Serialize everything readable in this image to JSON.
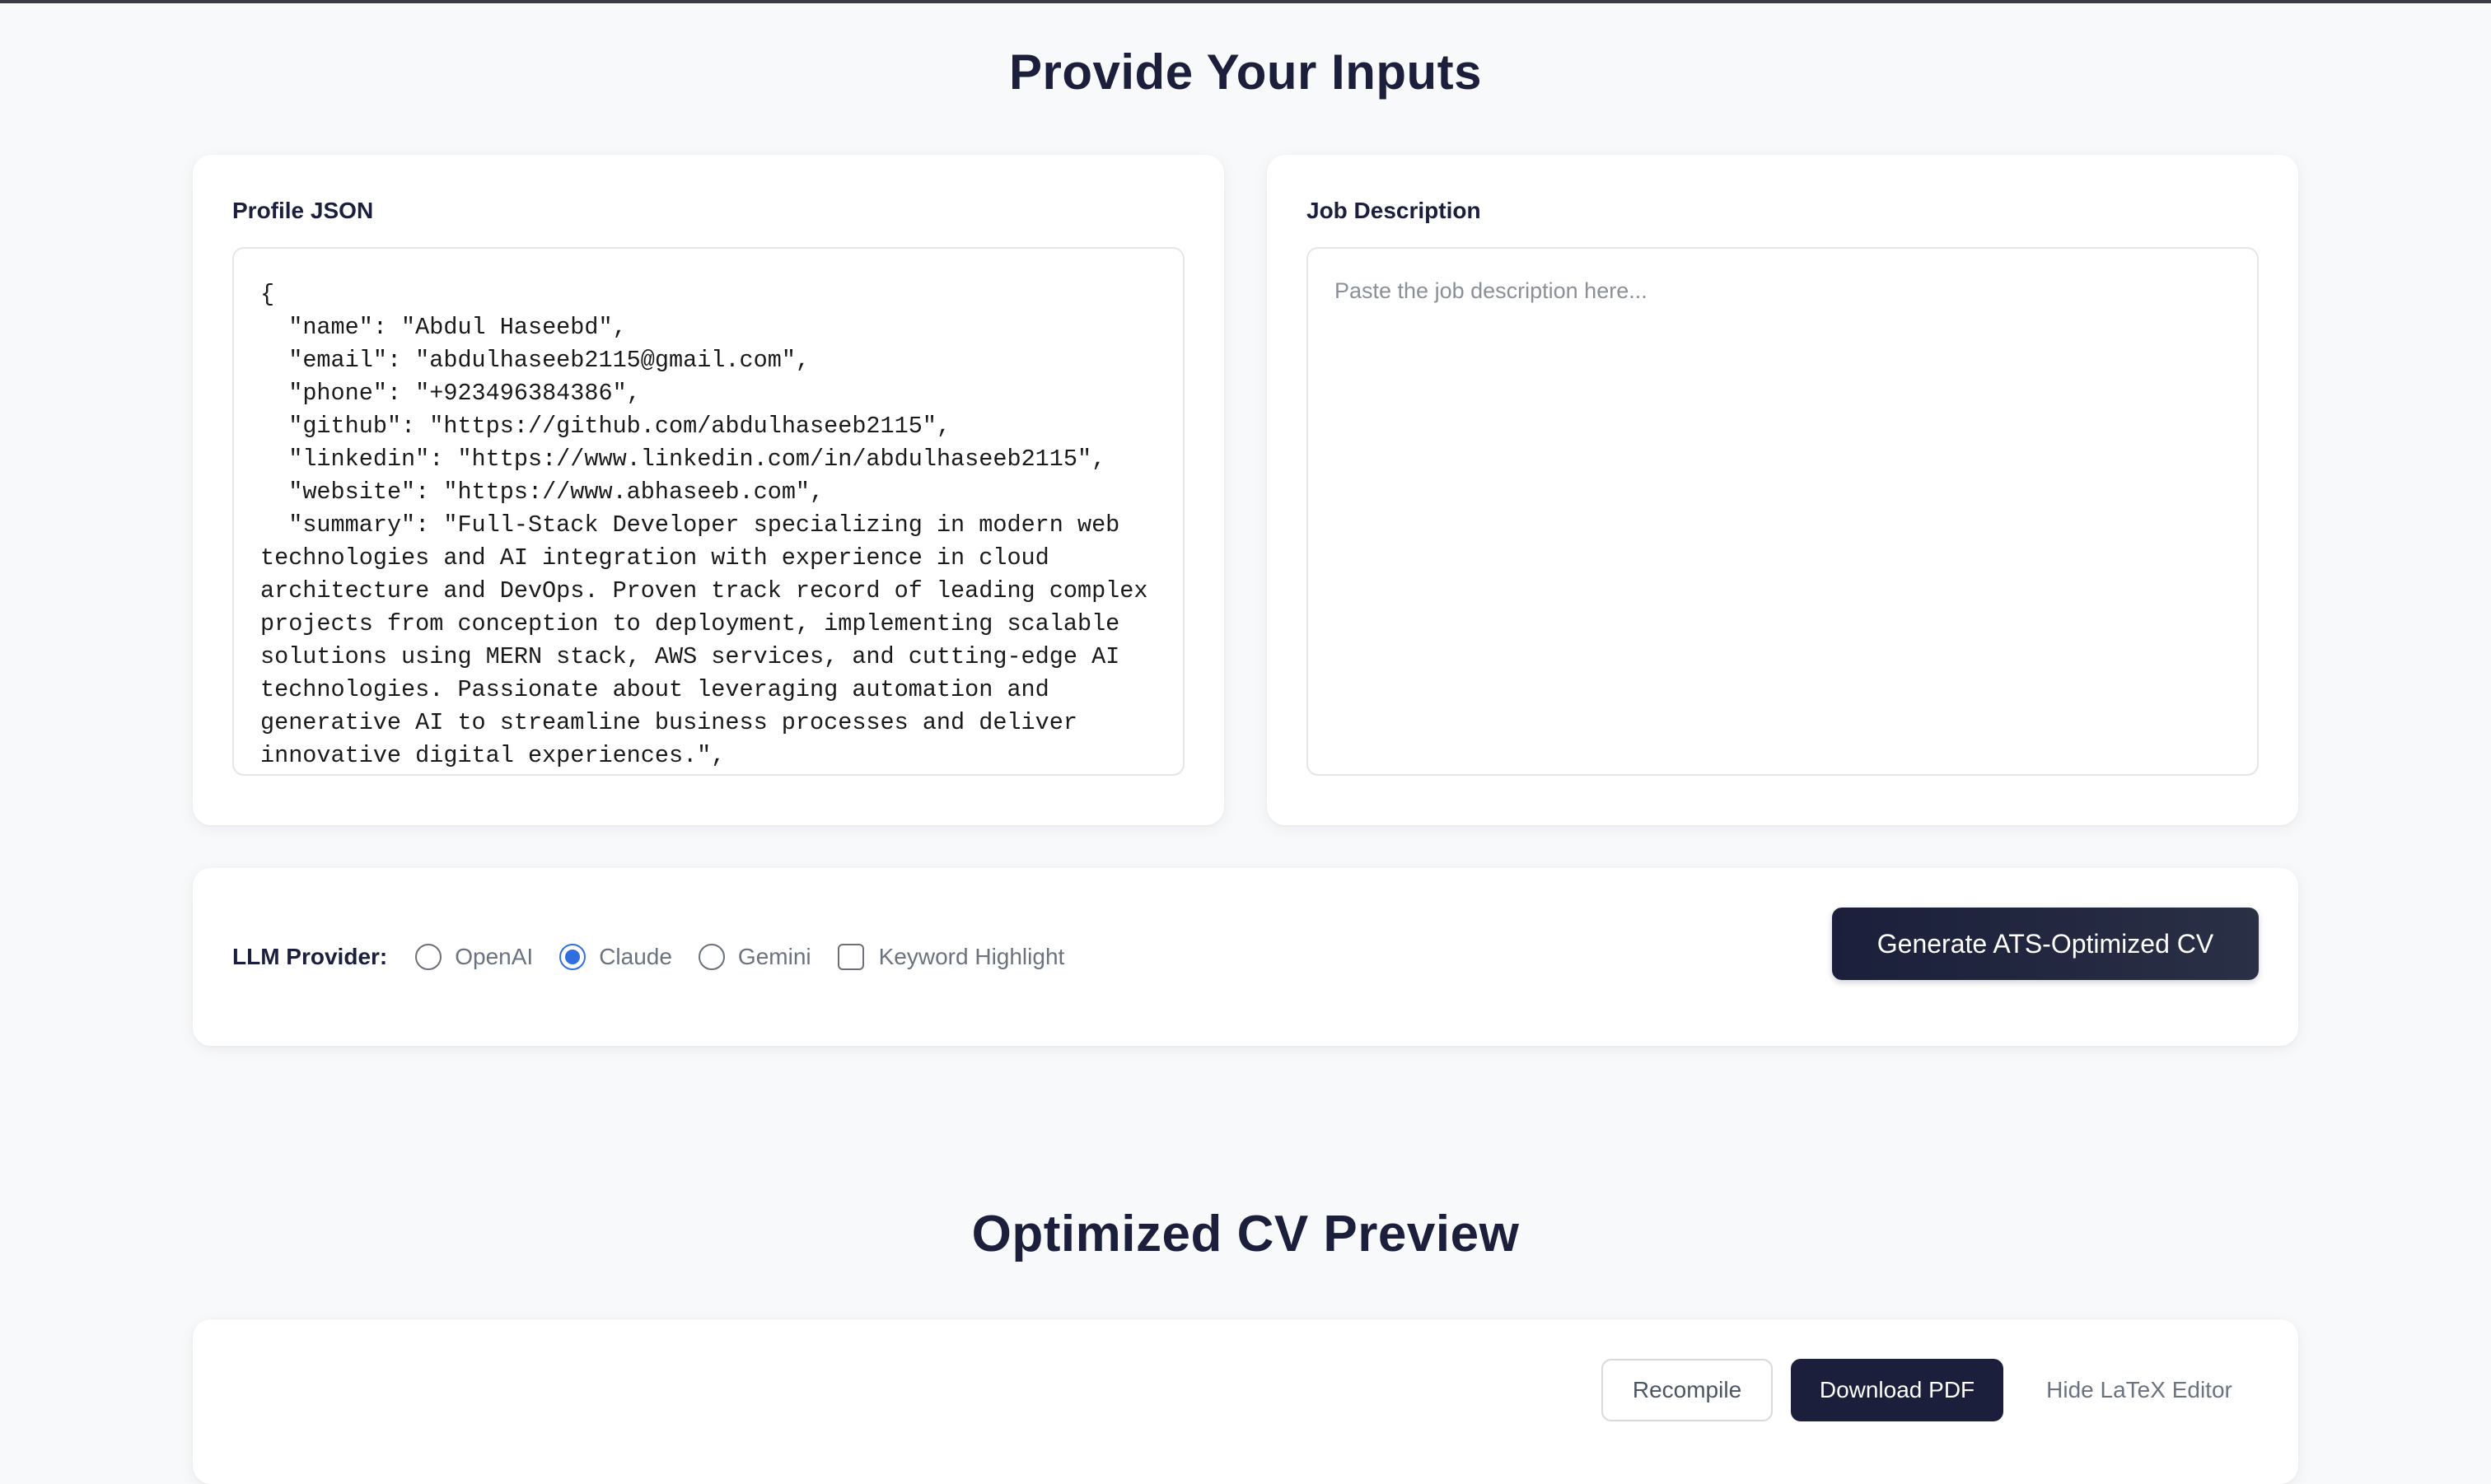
{
  "inputs_section": {
    "title": "Provide Your Inputs"
  },
  "profile": {
    "label": "Profile JSON",
    "value": "{\n  \"name\": \"Abdul Haseebd\",\n  \"email\": \"abdulhaseeb2115@gmail.com\",\n  \"phone\": \"+923496384386\",\n  \"github\": \"https://github.com/abdulhaseeb2115\",\n  \"linkedin\": \"https://www.linkedin.com/in/abdulhaseeb2115\",\n  \"website\": \"https://www.abhaseeb.com\",\n  \"summary\": \"Full-Stack Developer specializing in modern web technologies and AI integration with experience in cloud architecture and DevOps. Proven track record of leading complex projects from conception to deployment, implementing scalable solutions using MERN stack, AWS services, and cutting-edge AI technologies. Passionate about leveraging automation and generative AI to streamline business processes and deliver innovative digital experiences.\","
  },
  "job": {
    "label": "Job Description",
    "placeholder": "Paste the job description here..."
  },
  "controls": {
    "provider_label": "LLM Provider:",
    "providers": [
      {
        "label": "OpenAI",
        "checked": false
      },
      {
        "label": "Claude",
        "checked": true
      },
      {
        "label": "Gemini",
        "checked": false
      }
    ],
    "keyword_highlight": {
      "label": "Keyword Highlight",
      "checked": false
    },
    "generate_label": "Generate ATS-Optimized CV"
  },
  "preview_section": {
    "title": "Optimized CV Preview",
    "recompile_label": "Recompile",
    "download_label": "Download PDF",
    "hide_latex_label": "Hide LaTeX Editor"
  },
  "colors": {
    "primary": "#1b1f3b",
    "radio_accent": "#2f6fe0",
    "background": "#f8f9fa"
  }
}
